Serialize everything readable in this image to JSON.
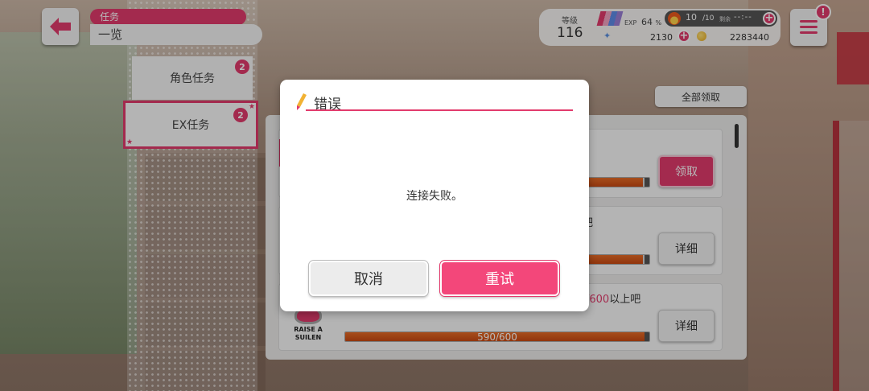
{
  "header": {
    "category_label": "任务",
    "page_label": "一览"
  },
  "side_tabs": [
    {
      "label": "角色任务",
      "badge": "2"
    },
    {
      "label": "EX任务",
      "badge": "2"
    }
  ],
  "status": {
    "level_label": "等级",
    "level": "116",
    "exp_label": "EXP",
    "exp_percent": "64",
    "exp_percent_suffix": "%",
    "stamina_current": "10",
    "stamina_max": "/10",
    "stamina_remaining_label": "剩余",
    "stamina_timer": "--:--",
    "star_gems": "2130",
    "coins": "2283440",
    "plus_symbol": "+"
  },
  "menu": {
    "alert_mark": "!"
  },
  "mission_list": {
    "claim_all_label": "全部领取",
    "rows": [
      {
        "button": "领取",
        "progress_fraction": 0.98
      },
      {
        "text_tail": "吧",
        "button": "详细",
        "progress_fraction": 0.98
      },
      {
        "text_value": "/600",
        "text_tail": "以上吧",
        "band_logo": "RAISE A SUILEN",
        "progress_text": "590/600",
        "progress_fraction": 0.983,
        "button": "详细"
      }
    ]
  },
  "dialog": {
    "title": "错误",
    "message": "连接失败。",
    "cancel_label": "取消",
    "retry_label": "重试"
  },
  "colors": {
    "accent": "#e23b6c",
    "progress": "#e76d28"
  },
  "icons": {
    "back": "back-arrow-icon",
    "menu": "hamburger-menu-icon",
    "stamina": "flame-icon",
    "star_gem": "star-gem-icon",
    "coin": "coin-icon",
    "dialog": "pencil-icon"
  }
}
